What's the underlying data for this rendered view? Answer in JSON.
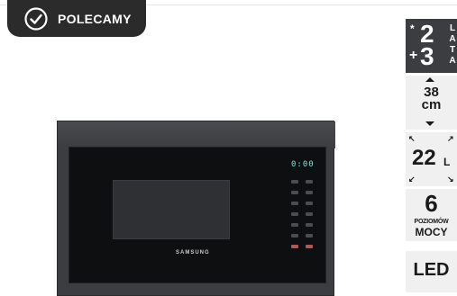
{
  "badge": {
    "label": "POLECAMY",
    "icon": "check-circle-icon"
  },
  "product": {
    "brand": "SAMSUNG",
    "display": "0:00"
  },
  "features": {
    "warranty": {
      "star": "*",
      "value1": "2",
      "plus": "+",
      "value2": "3",
      "unit_letters": [
        "L",
        "A",
        "T",
        "A"
      ]
    },
    "width": {
      "value": "38",
      "unit": "cm"
    },
    "capacity": {
      "value": "22",
      "unit": "L"
    },
    "power_levels": {
      "value": "6",
      "line1": "POZIOMÓW",
      "line2": "MOCY"
    },
    "led": {
      "label": "LED"
    }
  },
  "colors": {
    "badge": "#2b2b2b",
    "tile": "#f0f0f0",
    "tile_dark": "#3b3d40",
    "display": "#7ee6d9"
  }
}
